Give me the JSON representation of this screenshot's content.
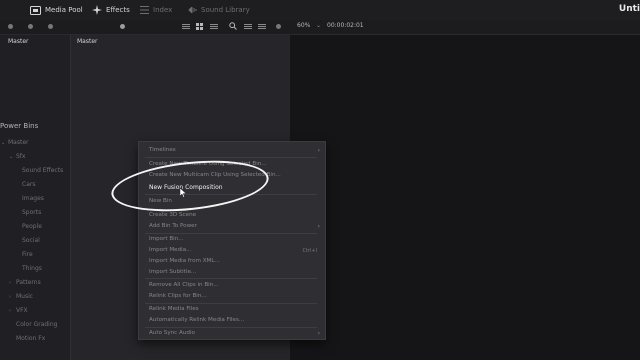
{
  "topbar": {
    "tabs": [
      {
        "label": "Media Pool",
        "icon": "media-pool-icon"
      },
      {
        "label": "Effects",
        "icon": "effects-icon"
      },
      {
        "label": "Index",
        "icon": "index-icon"
      },
      {
        "label": "Sound Library",
        "icon": "sound-library-icon"
      }
    ],
    "app_title": "Unti"
  },
  "toolbar": {
    "zoom": "60%",
    "timecode": "00:00:02:01"
  },
  "panels": {
    "bins_header": "Master",
    "media_header": "Master"
  },
  "power_bins": {
    "title": "Power Bins",
    "items": [
      {
        "label": "Master",
        "caret": "⌄"
      },
      {
        "label": "Sfx",
        "caret": "⌄"
      },
      {
        "label": "Sound Effects",
        "caret": ""
      },
      {
        "label": "Cars",
        "caret": ""
      },
      {
        "label": "Images",
        "caret": ""
      },
      {
        "label": "Sports",
        "caret": ""
      },
      {
        "label": "People",
        "caret": ""
      },
      {
        "label": "Social",
        "caret": ""
      },
      {
        "label": "Fire",
        "caret": ""
      },
      {
        "label": "Things",
        "caret": ""
      },
      {
        "label": "Patterns",
        "caret": "›"
      },
      {
        "label": "Music",
        "caret": "›"
      },
      {
        "label": "VFX",
        "caret": "›"
      },
      {
        "label": "Color Grading",
        "caret": ""
      },
      {
        "label": "Motion Fx",
        "caret": ""
      }
    ]
  },
  "context_menu": {
    "items": [
      {
        "label": "Timelines",
        "shortcut": "",
        "submenu": true,
        "highlight": false
      },
      {
        "label": "Create New Timeline Using Selected Bin...",
        "shortcut": "",
        "submenu": false,
        "highlight": false
      },
      {
        "label": "Create New Multicam Clip Using Selected Bin...",
        "shortcut": "",
        "submenu": false,
        "highlight": false
      },
      {
        "label": "New Fusion Composition",
        "shortcut": "",
        "submenu": false,
        "highlight": true
      },
      {
        "label": "New Bin",
        "shortcut": "",
        "submenu": false,
        "highlight": false
      },
      {
        "label": "Create 3D Scene",
        "shortcut": "",
        "submenu": false,
        "highlight": false
      },
      {
        "label": "Add Bin To Power",
        "shortcut": "",
        "submenu": true,
        "highlight": false
      },
      {
        "label": "Import Bin...",
        "shortcut": "",
        "submenu": false,
        "highlight": false
      },
      {
        "label": "Import Media...",
        "shortcut": "Ctrl+I",
        "submenu": false,
        "highlight": false
      },
      {
        "label": "Import Media from XML...",
        "shortcut": "",
        "submenu": false,
        "highlight": false
      },
      {
        "label": "Import Subtitle...",
        "shortcut": "",
        "submenu": false,
        "highlight": false
      },
      {
        "label": "Remove All Clips in Bin...",
        "shortcut": "",
        "submenu": false,
        "highlight": false
      },
      {
        "label": "Relink Clips for Bin...",
        "shortcut": "",
        "submenu": false,
        "highlight": false
      },
      {
        "label": "Relink Media Files",
        "shortcut": "",
        "submenu": false,
        "highlight": false
      },
      {
        "label": "Automatically Relink Media Files...",
        "shortcut": "",
        "submenu": false,
        "highlight": false
      },
      {
        "label": "Auto Sync Audio",
        "shortcut": "",
        "submenu": true,
        "highlight": false
      }
    ]
  },
  "colors": {
    "accent_annotation": "#f4f4f4",
    "panel_bg": "#26262a",
    "menu_bg": "#2f2f33"
  }
}
